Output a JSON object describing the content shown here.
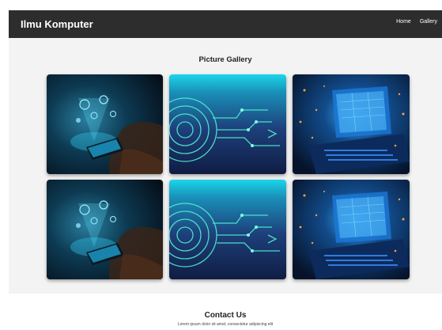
{
  "navbar": {
    "brand": "Ilmu Komputer",
    "links": [
      "Home",
      "Gallery"
    ]
  },
  "gallery": {
    "title": "Picture Gallery",
    "images": [
      "hand-phone-hologram",
      "circuit-tech-circles",
      "laptop-digital-glow",
      "hand-phone-hologram",
      "circuit-tech-circles",
      "laptop-digital-glow"
    ]
  },
  "contact": {
    "title": "Contact Us",
    "text": "Lorem ipsum dolor sit amet, consectetur adipiscing elit"
  },
  "colors": {
    "navbar_bg": "#2d2d2d",
    "page_bg": "#f3f3f3",
    "accent_cyan": "#19d3e6"
  }
}
